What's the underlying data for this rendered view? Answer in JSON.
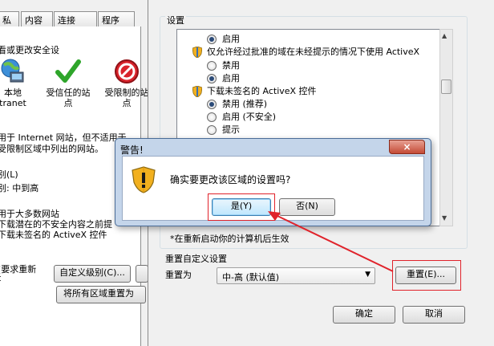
{
  "left_dialog": {
    "tabs": [
      "私",
      "内容",
      "连接",
      "程序"
    ],
    "heading": "看或更改安全设",
    "zones": [
      {
        "label": "本地",
        "sub": "tranet",
        "icon": "globe-computer-icon"
      },
      {
        "label": "受信任的站",
        "sub": "点",
        "icon": "trusted-check-icon"
      },
      {
        "label": "受限制的站",
        "sub": "点",
        "icon": "restricted-icon"
      }
    ],
    "desc_line1": "用于 Internet 网站，但不适用于",
    "desc_line2": "受限制区域中列出的网站。",
    "level_group_label": "别(L)",
    "level_value": "别: 中到高",
    "level_desc": [
      "用于大多数网站",
      "下载潜在的不安全内容之前提",
      "下载未签名的 ActiveX 控件"
    ],
    "protected_mode": "(要求重新",
    "protected_mode_sub": "t",
    "custom_level_button": "自定义级别(C)...",
    "reset_all_button": "将所有区域重置为"
  },
  "settings_dialog": {
    "group_title": "设置",
    "items": [
      {
        "kind": "option",
        "label": "启用",
        "checked": true
      },
      {
        "kind": "header",
        "label": "仅允许经过批准的域在未经提示的情况下使用 ActiveX"
      },
      {
        "kind": "option",
        "label": "禁用",
        "checked": false
      },
      {
        "kind": "option",
        "label": "启用",
        "checked": true
      },
      {
        "kind": "header",
        "label": "下载未签名的 ActiveX 控件"
      },
      {
        "kind": "option",
        "label": "禁用 (推荐)",
        "checked": true
      },
      {
        "kind": "option",
        "label": "启用 (不安全)",
        "checked": false
      },
      {
        "kind": "option",
        "label": "提示",
        "checked": false
      }
    ],
    "restart_note": "*在重新启动你的计算机后生效",
    "reset_group_title": "重置自定义设置",
    "reset_to_label": "重置为",
    "reset_to_value": "中-高 (默认值)",
    "reset_button": "重置(E)...",
    "ok_button": "确定",
    "cancel_button": "取消"
  },
  "warning_dialog": {
    "title": "警告!",
    "message": "确实要更改该区域的设置吗?",
    "yes_button": "是(Y)",
    "no_button": "否(N)",
    "close_glyph": "×"
  },
  "colors": {
    "highlight_frame": "#e0232b",
    "arrow": "#e0232b",
    "dialog_chrome": "#c4d5ea"
  }
}
